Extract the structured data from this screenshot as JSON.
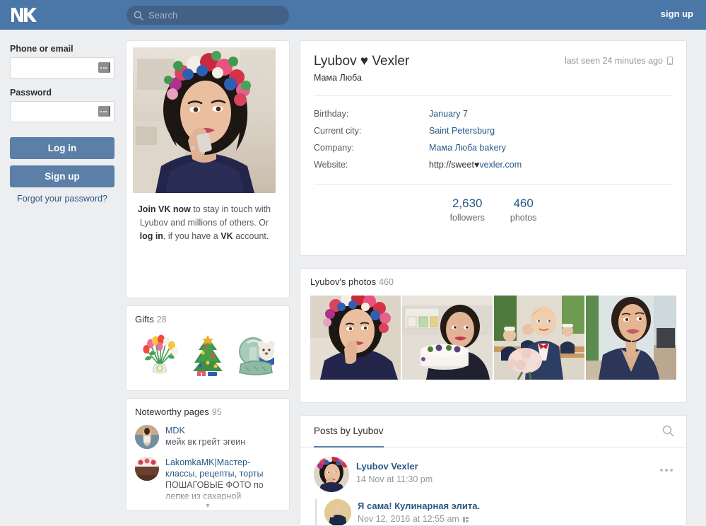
{
  "topbar": {
    "logo_icon": "vk-logo-icon",
    "search": {
      "icon": "search-icon",
      "placeholder": "Search",
      "value": ""
    },
    "signup_label": "sign up"
  },
  "login": {
    "phone_label": "Phone or email",
    "phone_value": "",
    "password_label": "Password",
    "password_value": "",
    "login_button": "Log in",
    "signup_button": "Sign up",
    "forgot_link": "Forgot your password?"
  },
  "photo_card": {
    "photo_alt": "profile-photo-woman-floral-crown",
    "join_line1_bold": "Join VK now",
    "join_line1_rest": " to stay in touch with",
    "join_line2": "Lyubov and millions of others.",
    "join_line3_pre": "Or ",
    "join_line3_link": "log in",
    "join_line3_mid": ", if you have a ",
    "join_line3_bold": "VK",
    "join_line4": "account."
  },
  "gifts": {
    "title": "Gifts",
    "count": "28",
    "items": [
      {
        "name": "gift-tulips-bouquet"
      },
      {
        "name": "gift-christmas-tree"
      },
      {
        "name": "gift-snow-globe-bear"
      }
    ]
  },
  "noteworthy": {
    "title": "Noteworthy pages",
    "count": "95",
    "items": [
      {
        "name": "MDK",
        "desc": "мейк вк грейт эгеин",
        "avatar": "avatar-mdk"
      },
      {
        "name": "LakomkaMK|Мастер-классы, рецепты, торты",
        "desc": "ПОШАГОВЫЕ ФОТО по лепке из сахарной",
        "avatar": "avatar-lakomka-cake"
      }
    ]
  },
  "profile": {
    "name": "Lyubov ♥ Vexler",
    "status": "Мама Люба",
    "last_seen": "last seen 24 minutes ago",
    "last_seen_icon": "mobile-phone-icon",
    "rows": [
      {
        "key": "Birthday:",
        "value": "January 7",
        "link": true
      },
      {
        "key": "Current city:",
        "value": "Saint Petersburg",
        "link": true
      },
      {
        "key": "Company:",
        "value": "Мама Люба bakery",
        "link": true
      }
    ],
    "website": {
      "key": "Website:",
      "plain_part": "http://sweet",
      "heart": "♥",
      "link_part": "vexler.com"
    },
    "counters": [
      {
        "num": "2,630",
        "label": "followers"
      },
      {
        "num": "460",
        "label": "photos"
      }
    ]
  },
  "photos": {
    "title": "Lyubov's photos",
    "count": "460",
    "thumbs": [
      {
        "name": "photo-thumb-woman-floral-crown"
      },
      {
        "name": "photo-thumb-woman-holding-cake"
      },
      {
        "name": "photo-thumb-boy-with-roses-classroom"
      },
      {
        "name": "photo-thumb-woman-blue-dress"
      }
    ]
  },
  "posts": {
    "tab_label": "Posts by Lyubov",
    "search_icon": "search-icon",
    "entries": [
      {
        "author": "Lyubov Vexler",
        "date": "14 Nov at 11:30 pm",
        "avatar": "avatar-lyubov-floral-crown",
        "menu_icon": "more-options-icon",
        "repost": {
          "name": "Я сама! Кулинарная элита.",
          "date": "Nov 12, 2016 at 12:55 am",
          "date_icon": "grid-icon",
          "avatar": "avatar-group-flexing-woman"
        }
      }
    ]
  },
  "colors": {
    "brand_blue": "#4a76a8",
    "button_blue": "#5b7fa6",
    "link_blue": "#2a5885",
    "page_bg": "#edeef0",
    "card_bg": "#ffffff",
    "muted_text": "#939699"
  }
}
